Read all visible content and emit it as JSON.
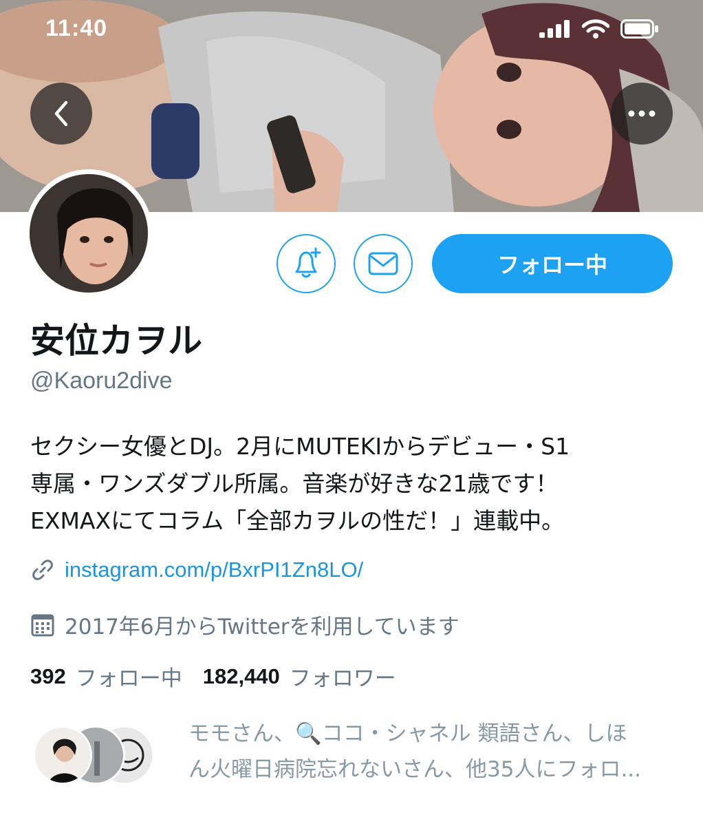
{
  "status_bar": {
    "time": "11:40"
  },
  "header": {
    "back_icon": "chevron-left-icon",
    "more_icon": "more-horizontal-icon"
  },
  "profile": {
    "name": "安位カヲル",
    "handle": "@Kaoru2dive",
    "bio": [
      "セクシー女優とDJ。2月にMUTEKIからデビュー・S1",
      "専属・ワンズダブル所属。音楽が好きな21歳です！",
      "EXMAXにてコラム「全部カヲルの性だ！」連載中。"
    ],
    "link": "instagram.com/p/BxrPI1Zn8LO/",
    "joined": "2017年6月からTwitterを利用しています"
  },
  "actions": {
    "follow_label": "フォロー中",
    "bell_icon": "bell-plus-icon",
    "mail_icon": "mail-icon"
  },
  "stats": {
    "following_count": "392",
    "following_label": "フォロー中",
    "followers_count": "182,440",
    "followers_label": "フォロワー"
  },
  "followed_by": {
    "line1": "モモさん、🔍ココ・シャネル 類語さん、しほ",
    "line2": "ん火曜日病院忘れないさん、他35人にフォロ..."
  },
  "colors": {
    "accent": "#1da1f2",
    "link": "#1b95e0",
    "muted": "#657786"
  }
}
